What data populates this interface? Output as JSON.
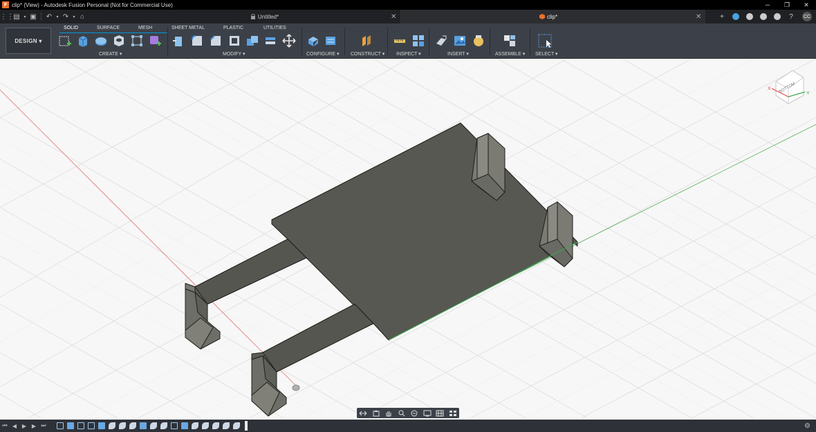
{
  "window": {
    "title": "clip* (View) - Autodesk Fusion Personal (Not for Commercial Use)",
    "minimize": "─",
    "restore": "❐",
    "close": "✕"
  },
  "tabs": [
    {
      "label": "Untitled*",
      "close": "✕"
    },
    {
      "label": "clip*",
      "close": "✕"
    }
  ],
  "quick_access": {
    "new": "+",
    "user_initials": "CC"
  },
  "ribbon": {
    "workspace": "DESIGN",
    "tabs": [
      "SOLID",
      "SURFACE",
      "MESH",
      "SHEET METAL",
      "PLASTIC",
      "UTILITIES"
    ],
    "groups": [
      "CREATE",
      "MODIFY",
      "CONFIGURE",
      "CONSTRUCT",
      "INSPECT",
      "INSERT",
      "ASSEMBLE",
      "SELECT"
    ]
  },
  "viewcube": {
    "face_label": "BOTTOM",
    "axis_x": "X",
    "axis_y": "Y"
  },
  "colors": {
    "accent": "#0696d7",
    "part": "#575852",
    "part_side": "#6e6e68",
    "x_axis": "#e05050",
    "y_axis": "#3aa64a"
  }
}
